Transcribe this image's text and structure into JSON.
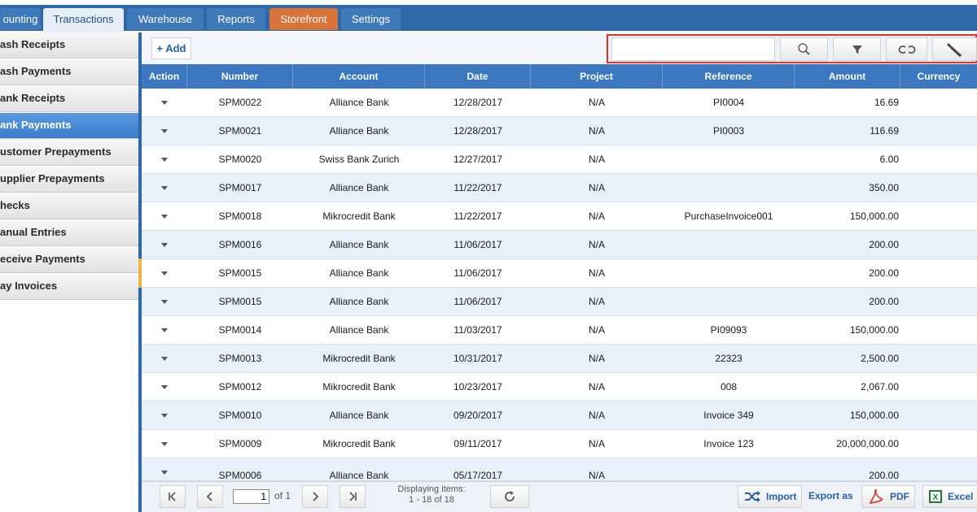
{
  "tabs": [
    {
      "label": "ounting"
    },
    {
      "label": "Transactions"
    },
    {
      "label": "Warehouse"
    },
    {
      "label": "Reports"
    },
    {
      "label": "Storefront"
    },
    {
      "label": "Settings"
    }
  ],
  "sidebar": {
    "items": [
      {
        "label": "ash Receipts"
      },
      {
        "label": "ash Payments"
      },
      {
        "label": "ank Receipts"
      },
      {
        "label": "ank Payments"
      },
      {
        "label": "ustomer Prepayments"
      },
      {
        "label": "upplier Prepayments"
      },
      {
        "label": "hecks"
      },
      {
        "label": "anual Entries"
      },
      {
        "label": "eceive Payments"
      },
      {
        "label": "ay Invoices"
      }
    ],
    "active_index": 3
  },
  "toolbar": {
    "add_label": "+ Add",
    "search_value": "",
    "search_placeholder": "",
    "search_highlight_color": "#e0312c"
  },
  "grid": {
    "columns": [
      "Action",
      "Number",
      "Account",
      "Date",
      "Project",
      "Reference",
      "Amount",
      "Currency"
    ],
    "rows": [
      {
        "number": "SPM0022",
        "account": "Alliance Bank",
        "date": "12/28/2017",
        "project": "N/A",
        "reference": "PI0004",
        "amount": "16.69",
        "currency": ""
      },
      {
        "number": "SPM0021",
        "account": "Alliance Bank",
        "date": "12/28/2017",
        "project": "N/A",
        "reference": "PI0003",
        "amount": "116.69",
        "currency": ""
      },
      {
        "number": "SPM0020",
        "account": "Swiss Bank Zurich",
        "date": "12/27/2017",
        "project": "N/A",
        "reference": "",
        "amount": "6.00",
        "currency": ""
      },
      {
        "number": "SPM0017",
        "account": "Alliance Bank",
        "date": "11/22/2017",
        "project": "N/A",
        "reference": "",
        "amount": "350.00",
        "currency": ""
      },
      {
        "number": "SPM0018",
        "account": "Mikrocredit Bank",
        "date": "11/22/2017",
        "project": "N/A",
        "reference": "PurchaseInvoice001",
        "amount": "150,000.00",
        "currency": ""
      },
      {
        "number": "SPM0016",
        "account": "Alliance Bank",
        "date": "11/06/2017",
        "project": "N/A",
        "reference": "",
        "amount": "200.00",
        "currency": ""
      },
      {
        "number": "SPM0015",
        "account": "Alliance Bank",
        "date": "11/06/2017",
        "project": "N/A",
        "reference": "",
        "amount": "200.00",
        "currency": ""
      },
      {
        "number": "SPM0015",
        "account": "Alliance Bank",
        "date": "11/06/2017",
        "project": "N/A",
        "reference": "",
        "amount": "200.00",
        "currency": ""
      },
      {
        "number": "SPM0014",
        "account": "Alliance Bank",
        "date": "11/03/2017",
        "project": "N/A",
        "reference": "PI09093",
        "amount": "150,000.00",
        "currency": ""
      },
      {
        "number": "SPM0013",
        "account": "Mikrocredit Bank",
        "date": "10/31/2017",
        "project": "N/A",
        "reference": "22323",
        "amount": "2,500.00",
        "currency": ""
      },
      {
        "number": "SPM0012",
        "account": "Mikrocredit Bank",
        "date": "10/23/2017",
        "project": "N/A",
        "reference": "008",
        "amount": "2,067.00",
        "currency": ""
      },
      {
        "number": "SPM0010",
        "account": "Alliance Bank",
        "date": "09/20/2017",
        "project": "N/A",
        "reference": "Invoice 349",
        "amount": "150,000.00",
        "currency": ""
      },
      {
        "number": "SPM0009",
        "account": "Mikrocredit Bank",
        "date": "09/11/2017",
        "project": "N/A",
        "reference": "Invoice 123",
        "amount": "20,000,000.00",
        "currency": ""
      },
      {
        "number": "SPM0006",
        "account": "Alliance Bank",
        "date": "05/17/2017",
        "project": "N/A",
        "reference": "",
        "amount": "200.00",
        "currency": ""
      }
    ]
  },
  "footer": {
    "page_value": "1",
    "of_label": "of  1",
    "displaying_label": "Displaying items:",
    "displaying_range": "1 - 18 of 18",
    "import_label": "Import",
    "export_as_label": "Export as",
    "pdf_label": "PDF",
    "excel_label": "Excel"
  },
  "colors": {
    "accent": "#2f68a8",
    "header": "#3b78bf",
    "active_sidebar": "#3b7ccc",
    "storefront_tab": "#d8733a"
  }
}
